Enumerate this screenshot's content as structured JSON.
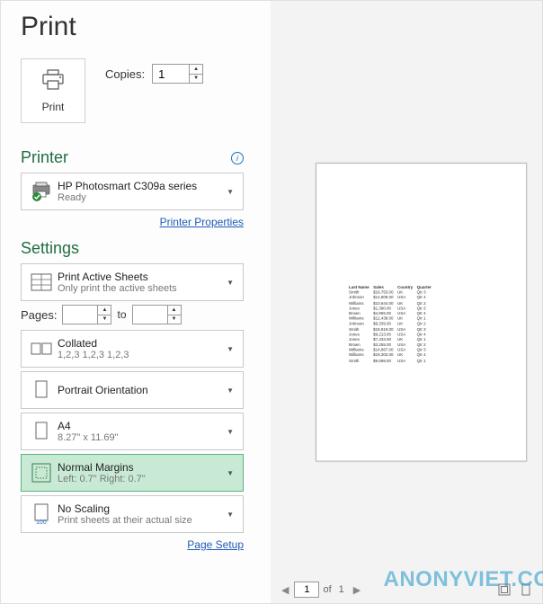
{
  "page_title": "Print",
  "print_button_label": "Print",
  "copies_label": "Copies:",
  "copies_value": "1",
  "printer_section": "Printer",
  "printer": {
    "name": "HP Photosmart C309a series",
    "status": "Ready"
  },
  "printer_properties_link": "Printer Properties",
  "settings_section": "Settings",
  "settings": {
    "what_to_print": {
      "primary": "Print Active Sheets",
      "secondary": "Only print the active sheets"
    },
    "collated": {
      "primary": "Collated",
      "secondary": "1,2,3    1,2,3    1,2,3"
    },
    "orientation": {
      "primary": "Portrait Orientation"
    },
    "paper": {
      "primary": "A4",
      "secondary": "8.27\" x 11.69\""
    },
    "margins": {
      "primary": "Normal Margins",
      "secondary": "Left:  0.7\"    Right:  0.7\""
    },
    "scaling": {
      "primary": "No Scaling",
      "secondary": "Print sheets at their actual size"
    }
  },
  "pages_label": "Pages:",
  "pages_from": "",
  "pages_to_label": "to",
  "pages_to": "",
  "page_setup_link": "Page Setup",
  "preview": {
    "current_page": "1",
    "total_pages": "1",
    "of_label": "of"
  },
  "watermark": "ANONYVIET.COM",
  "chart_data": {
    "type": "table",
    "headers": [
      "Last Name",
      "Sales",
      "Country",
      "Quarter"
    ],
    "rows": [
      [
        "Smith",
        "$16,753.00",
        "UK",
        "Qtr 3"
      ],
      [
        "Johnson",
        "$14,808.00",
        "USA",
        "Qtr 4"
      ],
      [
        "Williams",
        "$10,644.00",
        "UK",
        "Qtr 2"
      ],
      [
        "Jones",
        "$1,390.00",
        "USA",
        "Qtr 3"
      ],
      [
        "Brown",
        "$4,865.00",
        "USA",
        "Qtr 4"
      ],
      [
        "Williams",
        "$12,438.00",
        "UK",
        "Qtr 1"
      ],
      [
        "Johnson",
        "$9,339.00",
        "UK",
        "Qtr 2"
      ],
      [
        "Smith",
        "$18,919.00",
        "USA",
        "Qtr 3"
      ],
      [
        "Jones",
        "$9,213.00",
        "USA",
        "Qtr 4"
      ],
      [
        "Jones",
        "$7,433.00",
        "UK",
        "Qtr 1"
      ],
      [
        "Brown",
        "$3,255.00",
        "USA",
        "Qtr 2"
      ],
      [
        "Williams",
        "$14,867.00",
        "USA",
        "Qtr 3"
      ],
      [
        "Williams",
        "$19,302.00",
        "UK",
        "Qtr 4"
      ],
      [
        "Smith",
        "$9,698.00",
        "USA",
        "Qtr 1"
      ]
    ]
  }
}
